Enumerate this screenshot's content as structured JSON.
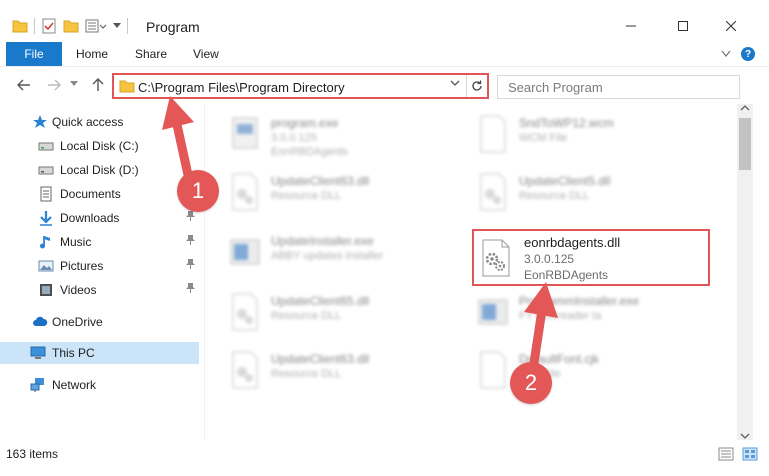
{
  "window": {
    "title": "Program"
  },
  "ribbon": {
    "tabs": [
      "File",
      "Home",
      "Share",
      "View"
    ]
  },
  "address_bar": {
    "path": "C:\\Program Files\\Program Directory"
  },
  "search": {
    "placeholder": "Search Program"
  },
  "sidebar": {
    "items": [
      {
        "label": "Quick access",
        "icon": "star-icon"
      },
      {
        "label": "Local Disk (C:)",
        "icon": "drive-icon"
      },
      {
        "label": "Local Disk (D:)",
        "icon": "drive-icon"
      },
      {
        "label": "Documents",
        "icon": "documents-icon"
      },
      {
        "label": "Downloads",
        "icon": "download-icon"
      },
      {
        "label": "Music",
        "icon": "music-icon"
      },
      {
        "label": "Pictures",
        "icon": "pictures-icon"
      },
      {
        "label": "Videos",
        "icon": "videos-icon"
      },
      {
        "label": "OneDrive",
        "icon": "cloud-icon"
      },
      {
        "label": "This PC",
        "icon": "computer-icon"
      },
      {
        "label": "Network",
        "icon": "network-icon"
      }
    ]
  },
  "files": {
    "left": [
      {
        "name": "program.exe",
        "line1": "3.0.0.125",
        "line2": "EonRBDAgents"
      },
      {
        "name": "UpdateClient63.dll",
        "line1": "Resource DLL",
        "line2": ""
      },
      {
        "name": "UpdateInstaller.exe",
        "line1": "ABBY updates installer",
        "line2": ""
      },
      {
        "name": "UpdateClient65.dll",
        "line1": "Resource DLL",
        "line2": ""
      },
      {
        "name": "UpdateClient63.dll",
        "line1": "Resource DLL",
        "line2": ""
      }
    ],
    "right": [
      {
        "name": "SndToWP12.wcm",
        "line1": "WCM File",
        "line2": ""
      },
      {
        "name": "UpdateClient5.dll",
        "line1": "Resource DLL",
        "line2": ""
      },
      {
        "name": "ProgrammInstaller.exe",
        "line1": "FY Finereader ta",
        "line2": ""
      },
      {
        "name": "DefaultFont.cjk",
        "line1": "CJK File",
        "line2": ""
      }
    ],
    "highlighted": {
      "name": "eonrbdagents.dll",
      "line1": "3.0.0.125",
      "line2": "EonRBDAgents"
    }
  },
  "annotations": {
    "step1": "1",
    "step2": "2"
  },
  "status": {
    "item_count": "163 items"
  },
  "colors": {
    "accent": "#1979ca",
    "highlight_red": "#e05555",
    "selected_bg": "#cce4f7"
  }
}
